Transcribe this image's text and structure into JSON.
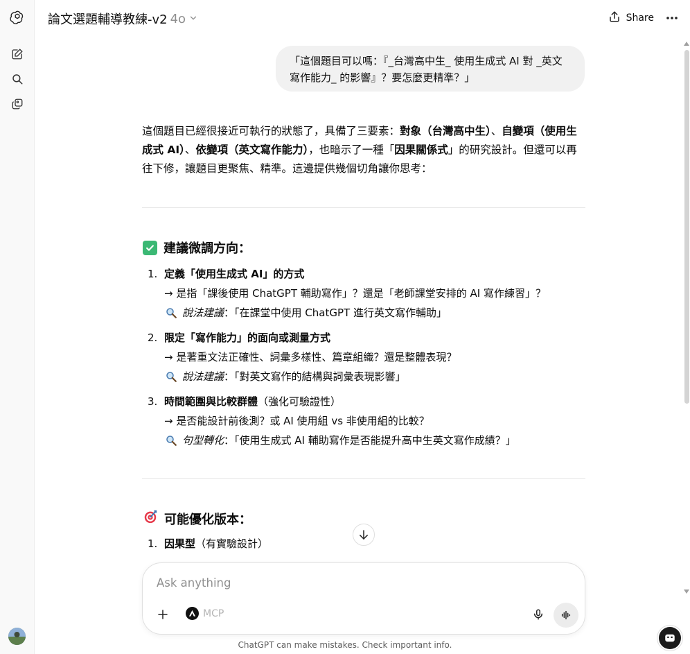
{
  "header": {
    "title": "論文選題輔導教練-v2",
    "model": "4o",
    "share_label": "Share"
  },
  "user_message": "「這個題目可以嗎：『_台灣高中生_ 使用生成式 AI 對 _英文寫作能力_ 的影響』？要怎麼更精準？」",
  "assistant": {
    "intro": [
      {
        "t": "這個題目已經很接近可執行的狀態了，具備了三要素：",
        "b": false
      },
      {
        "t": "對象（台灣高中生）",
        "b": true
      },
      {
        "t": "、",
        "b": false
      },
      {
        "t": "自變項（使用生成式 AI）",
        "b": true
      },
      {
        "t": "、",
        "b": false
      },
      {
        "t": "依變項（英文寫作能力）",
        "b": true
      },
      {
        "t": "，也暗示了一種「",
        "b": false
      },
      {
        "t": "因果關係式",
        "b": true
      },
      {
        "t": "」的研究設計。但還可以再往下修，讓題目更聚焦、精準。這邊提供幾個切角讓你思考：",
        "b": false
      }
    ],
    "section1": {
      "heading": "建議微調方向：",
      "items": [
        {
          "num": "1.",
          "head": "定義「使用生成式 AI」的方式",
          "head_normal": "",
          "arrow": "→ 是指「課後使用 ChatGPT 輔助寫作」？還是「老師課堂安排的 AI 寫作練習」？",
          "sugg_label": "說法建議",
          "sugg_text": "：「在課堂中使用 ChatGPT 進行英文寫作輔助」"
        },
        {
          "num": "2.",
          "head": "限定「寫作能力」的面向或測量方式",
          "head_normal": "",
          "arrow": "→ 是著重文法正確性、詞彙多樣性、篇章組織？還是整體表現？",
          "sugg_label": "說法建議",
          "sugg_text": "：「對英文寫作的結構與詞彙表現影響」"
        },
        {
          "num": "3.",
          "head": "時間範圍與比較群體",
          "head_normal": "（強化可驗證性）",
          "arrow": "→ 是否能設計前後測？或 AI 使用組 vs 非使用組的比較？",
          "sugg_label": "句型轉化",
          "sugg_text": "：「使用生成式 AI 輔助寫作是否能提升高中生英文寫作成績？」"
        }
      ]
    },
    "section2": {
      "heading": "可能優化版本：",
      "items": [
        {
          "num": "1.",
          "head": "因果型",
          "head_normal": "（有實驗設計）"
        }
      ]
    }
  },
  "composer": {
    "placeholder": "Ask anything",
    "mcp_label": "MCP"
  },
  "footer_note": "ChatGPT can make mistakes. Check important info.",
  "colors": {
    "accent_check": "#3bb874",
    "bubble_bg": "#f1f1f1"
  }
}
